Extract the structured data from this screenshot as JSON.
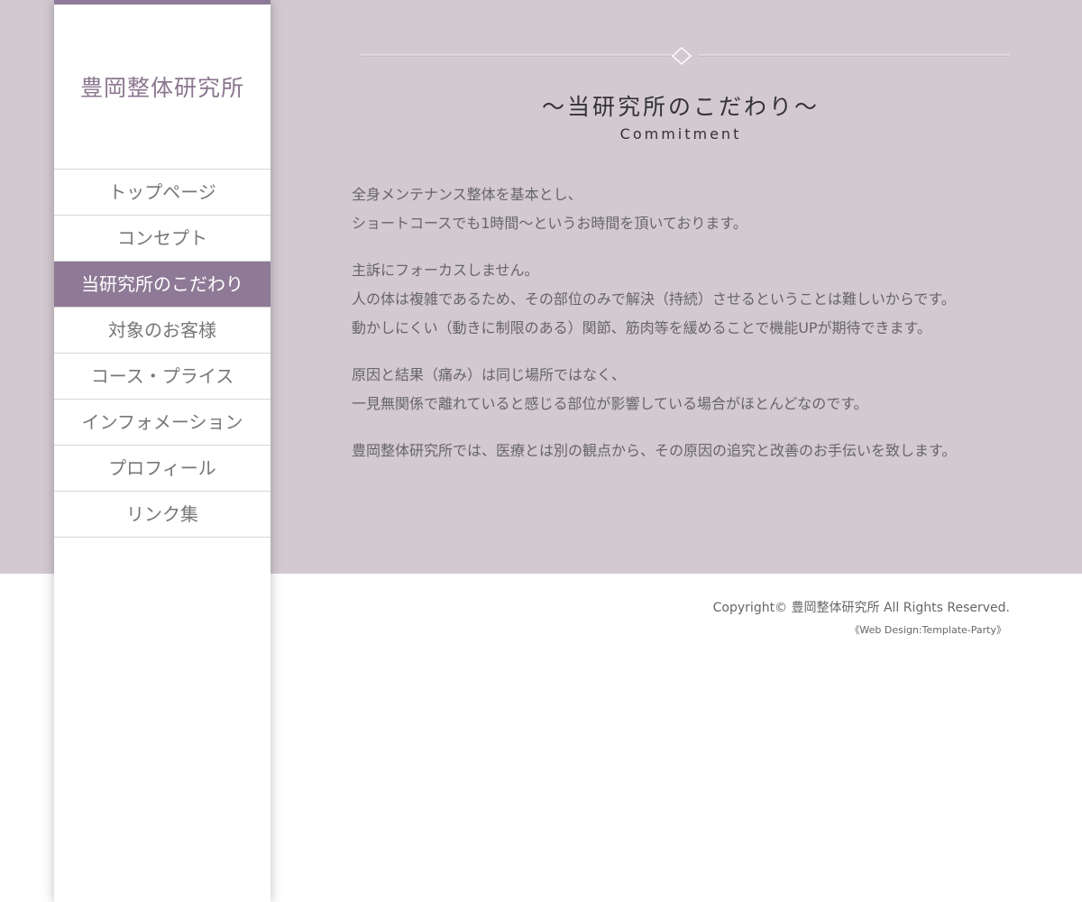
{
  "site": {
    "logo": "豊岡整体研究所"
  },
  "nav": {
    "items": [
      {
        "label": "トップページ"
      },
      {
        "label": "コンセプト"
      },
      {
        "label": "当研究所のこだわり"
      },
      {
        "label": "対象のお客様"
      },
      {
        "label": "コース・プライス"
      },
      {
        "label": "インフォメーション"
      },
      {
        "label": "プロフィール"
      },
      {
        "label": "リンク集"
      }
    ],
    "active_index": 2
  },
  "main": {
    "title": "〜当研究所のこだわり〜",
    "subtitle": "Commitment",
    "paragraphs": [
      {
        "lines": [
          "全身メンテナンス整体を基本とし、",
          "ショートコースでも1時間〜というお時間を頂いております。"
        ]
      },
      {
        "lines": [
          "主訴にフォーカスしません。",
          "人の体は複雑であるため、その部位のみで解決（持続）させるということは難しいからです。",
          "動かしにくい（動きに制限のある）関節、筋肉等を緩めることで機能UPが期待できます。"
        ]
      },
      {
        "lines": [
          "原因と結果（痛み）は同じ場所ではなく、",
          "一見無関係で離れていると感じる部位が影響している場合がほとんどなのです。"
        ]
      },
      {
        "lines": [
          "豊岡整体研究所では、医療とは別の観点から、その原因の追究と改善のお手伝いを致します。"
        ]
      }
    ]
  },
  "footer": {
    "copyright": "Copyright© 豊岡整体研究所 All Rights Reserved.",
    "credit": "《Web Design:Template-Party》"
  },
  "colors": {
    "accent": "#8e7a96",
    "main_background": "#d2c9d1",
    "footer_background": "#ffffff"
  }
}
